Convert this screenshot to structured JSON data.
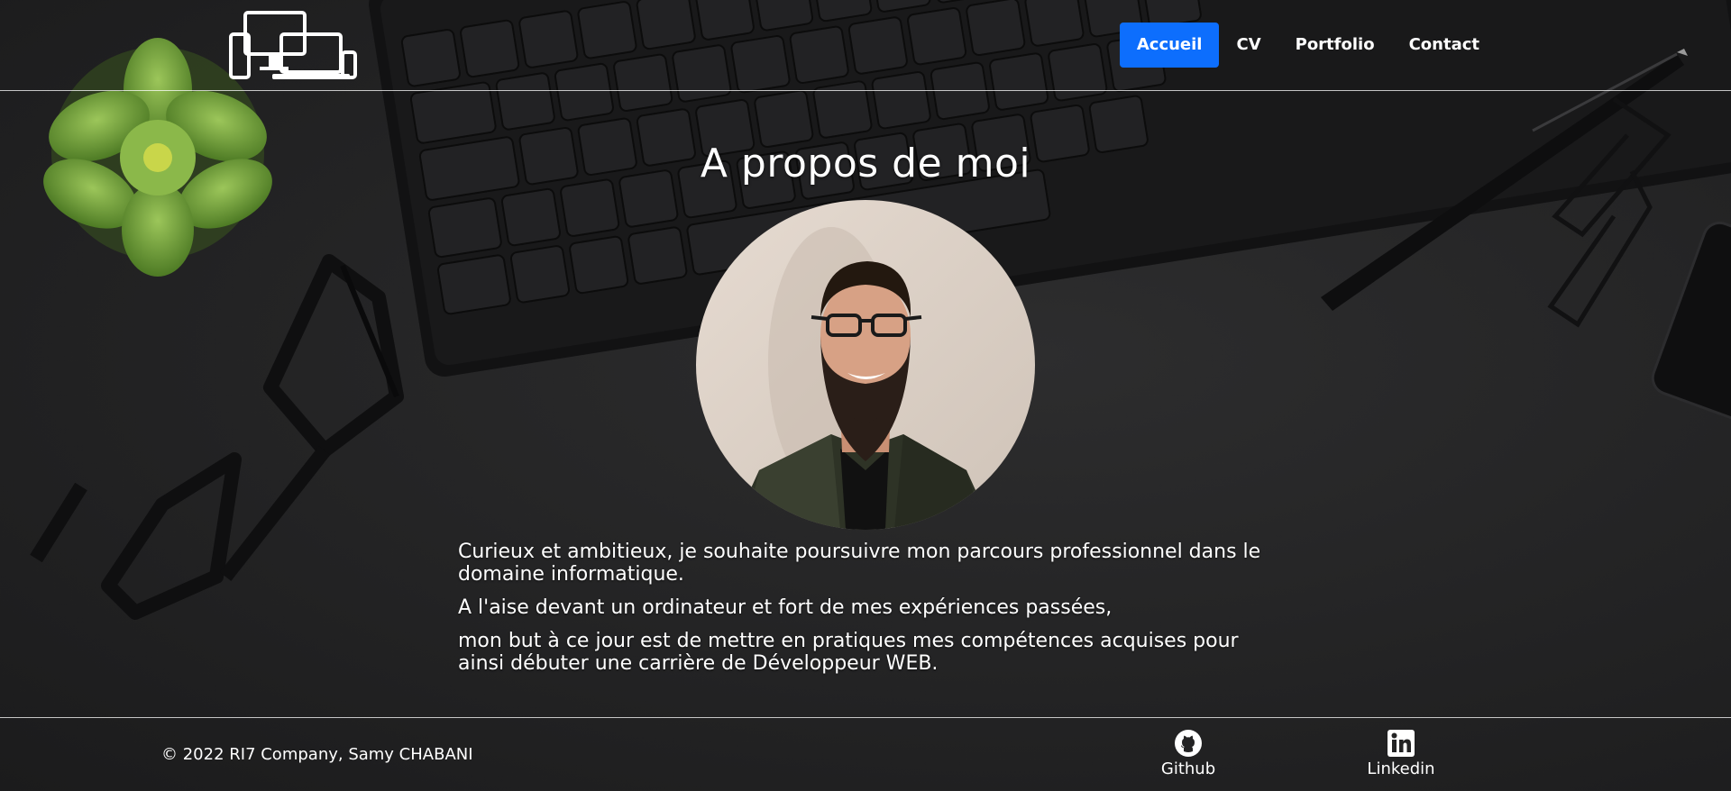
{
  "header": {
    "logo_icon": "devices-icon",
    "nav": [
      {
        "label": "Accueil",
        "active": true
      },
      {
        "label": "CV",
        "active": false
      },
      {
        "label": "Portfolio",
        "active": false
      },
      {
        "label": "Contact",
        "active": false
      }
    ]
  },
  "main": {
    "title": "A propos de moi",
    "paragraphs": [
      "Curieux et ambitieux, je souhaite poursuivre mon parcours professionnel dans le domaine informatique.",
      "A l'aise devant un ordinateur et fort de mes expériences passées,",
      "mon but à ce jour est de mettre en pratiques mes compétences acquises pour ainsi débuter une carrière de Développeur WEB."
    ]
  },
  "footer": {
    "copyright": "© 2022 RI7 Company, Samy CHABANI",
    "links": [
      {
        "label": "Github",
        "icon": "github-icon"
      },
      {
        "label": "Linkedin",
        "icon": "linkedin-icon"
      }
    ]
  },
  "colors": {
    "accent": "#0d6efd",
    "background": "#232324",
    "text": "#ffffff"
  }
}
